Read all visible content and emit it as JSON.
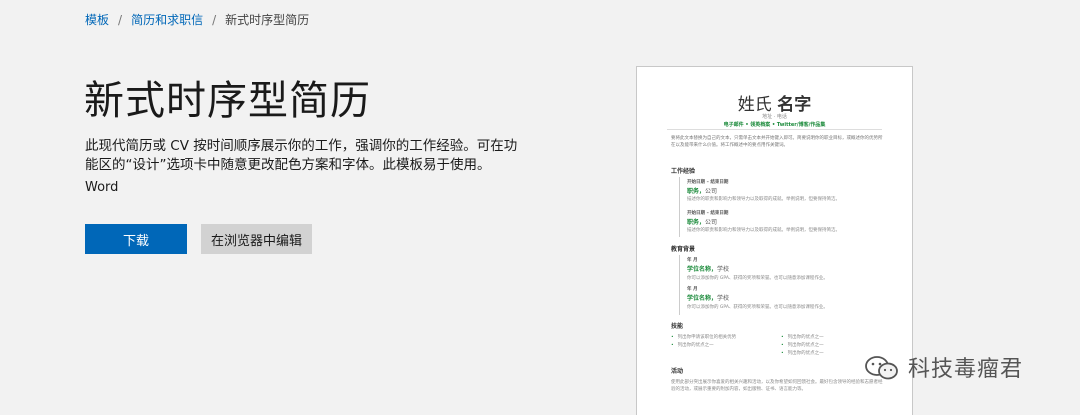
{
  "breadcrumb": {
    "items": [
      "模板",
      "简历和求职信"
    ],
    "current": "新式时序型简历"
  },
  "template": {
    "title": "新式时序型简历",
    "description": "此现代简历或 CV 按时间顺序展示你的工作，强调你的工作经验。可在功能区的“设计”选项卡中随意更改配色方案和字体。此模板易于使用。",
    "app": "Word",
    "download_label": "下载",
    "edit_label": "在浏览器中编辑"
  },
  "preview": {
    "name_first": "姓氏",
    "name_last": "名字",
    "address": "地址 · 电话",
    "contact": "电子邮件 • 领英档案 • Twitter/博客/作品集",
    "intro": "要将此文本替换为自己的文本，只需单击文本并开始键入即可。简要说明你的职业目标，或概述你的优势所在以及能带来什么价值。将工作概述中的要点用作关键词。",
    "sections": {
      "work": "工作经验",
      "education": "教育背景",
      "skills": "技能",
      "activities": "活动"
    },
    "work": [
      {
        "dates": "开始日期 – 结束日期",
        "role": "职务，",
        "company": "公司",
        "text": "描述你的职责和影响力和领导力以及取得的成就。举例说明，但要保持简洁。"
      },
      {
        "dates": "开始日期 – 结束日期",
        "role": "职务，",
        "company": "公司",
        "text": "描述你的职责和影响力和领导力以及取得的成就。举例说明，但要保持简洁。"
      }
    ],
    "education": [
      {
        "dates": "年 月",
        "degree": "学位名称，",
        "school": "学校",
        "text": "你可以添加你的 GPA、获得的奖项和荣誉。也可以随意添加课程作业。"
      },
      {
        "dates": "年 月",
        "degree": "学位名称，",
        "school": "学校",
        "text": "你可以添加你的 GPA、获得的奖项和荣誉。也可以随意添加课程作业。"
      }
    ],
    "skills_left": [
      "列出你申请该职位的相关优势",
      "列出你的优点之一"
    ],
    "skills_right": [
      "列出你的优点之一",
      "列出你的优点之一",
      "列出你的优点之一"
    ],
    "activities_text": "使用此部分突出展示你喜爱的相关兴趣和活动，以及你希望如何回馈社会。最好包含领导的经验和志愿者经验的活动，或展示重要的附加内容，如出版物、证书、语言能力等。"
  },
  "watermark": {
    "text": "科技毒瘤君",
    "icon": "wechat-icon"
  },
  "colors": {
    "accent": "#0067b8",
    "secondary_button": "#d2d2d2",
    "preview_green": "#1a8a3a"
  }
}
